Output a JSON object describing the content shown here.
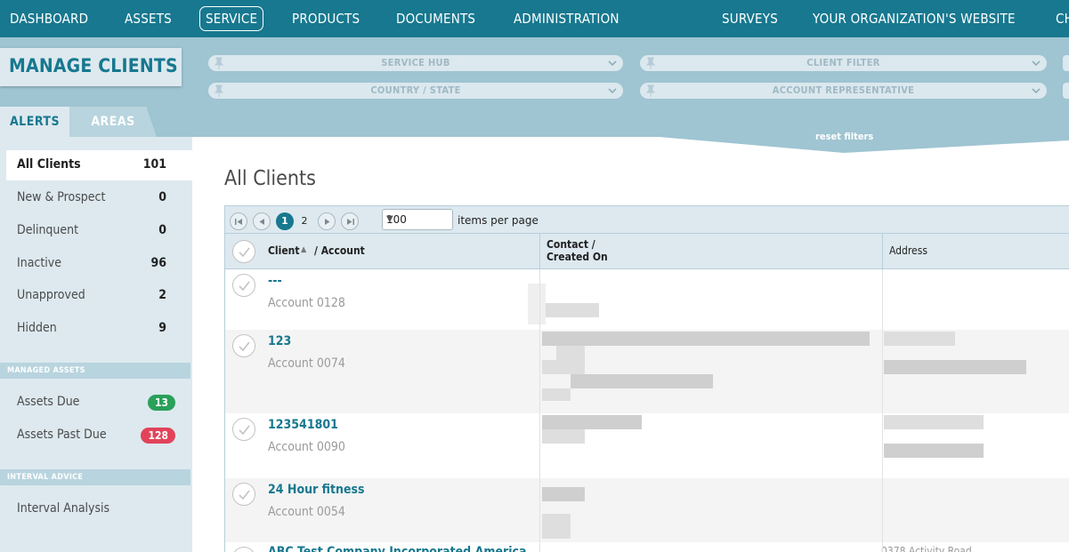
{
  "nav": {
    "items": [
      "DASHBOARD",
      "ASSETS",
      "SERVICE",
      "PRODUCTS",
      "DOCUMENTS",
      "ADMINISTRATION",
      "SURVEYS",
      "YOUR ORGANIZATION'S WEBSITE",
      "CH"
    ],
    "active": "SERVICE"
  },
  "page_header": {
    "title": "MANAGE CLIENTS"
  },
  "filters": {
    "service_hub": "SERVICE HUB",
    "client_filter": "CLIENT FILTER",
    "country_state": "COUNTRY / STATE",
    "account_rep": "ACCOUNT REPRESENTATIVE",
    "reset": "reset filters"
  },
  "tabs": {
    "alerts": "ALERTS",
    "areas": "AREAS"
  },
  "sidebar": {
    "items": [
      {
        "label": "All Clients",
        "count": "101"
      },
      {
        "label": "New & Prospect",
        "count": "0"
      },
      {
        "label": "Delinquent",
        "count": "0"
      },
      {
        "label": "Inactive",
        "count": "96"
      },
      {
        "label": "Unapproved",
        "count": "2"
      },
      {
        "label": "Hidden",
        "count": "9"
      }
    ],
    "managed_assets": {
      "header": "MANAGED ASSETS",
      "items": [
        {
          "label": "Assets Due",
          "count": "13"
        },
        {
          "label": "Assets Past Due",
          "count": "128"
        }
      ]
    },
    "interval_advice": {
      "header": "INTERVAL ADVICE",
      "items": [
        {
          "label": "Interval Analysis"
        }
      ]
    }
  },
  "main": {
    "title": "All Clients",
    "pager": {
      "pages": [
        "1",
        "2"
      ],
      "current": "1",
      "per_page": "100",
      "per_page_label": "items per page"
    },
    "columns": {
      "client": "Client",
      "sort_icon": "sort-ascending-icon",
      "account": "/ Account",
      "contact": "Contact /",
      "created_on": "Created On",
      "address": "Address"
    },
    "rows": [
      {
        "name": "---",
        "account": "Account 0128"
      },
      {
        "name": "123",
        "account": "Account 0074"
      },
      {
        "name": "123541801",
        "account": "Account 0090"
      },
      {
        "name": "24 Hour fitness",
        "account": "Account 0054"
      },
      {
        "name": "ABC Test Company Incorporated America",
        "account": "",
        "address": "0378 Activity Road"
      }
    ]
  },
  "colors": {
    "primary": "#17788f",
    "band": "#9fc4d2",
    "sidebar": "#dde9ef",
    "green": "#2aa05a",
    "red": "#e2435a"
  }
}
